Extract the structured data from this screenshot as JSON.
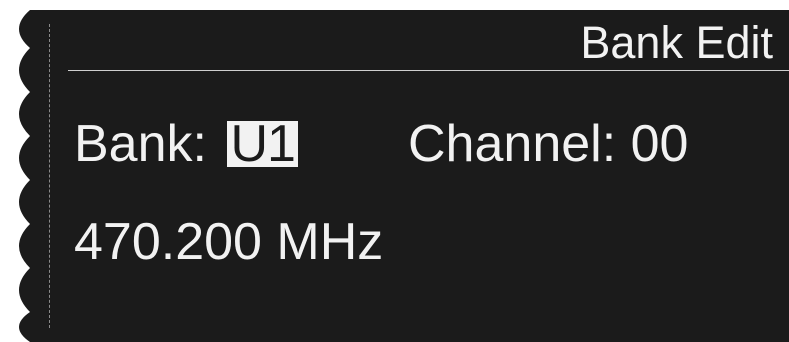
{
  "screen": {
    "title": "Bank Edit",
    "bank_label": "Bank:",
    "bank_value": "U1",
    "channel_label": "Channel:",
    "channel_value": "00",
    "frequency_value": "470.200",
    "frequency_unit": "MHz"
  },
  "colors": {
    "background": "#1b1b1b",
    "text": "#f2f2f2",
    "highlight_bg": "#f2f2f2",
    "highlight_text": "#1b1b1b"
  }
}
